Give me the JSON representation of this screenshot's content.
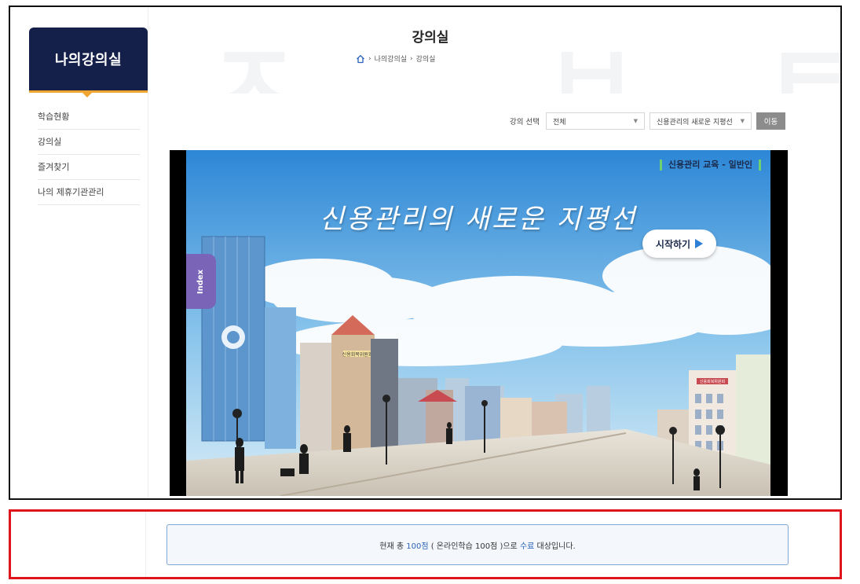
{
  "sidebar": {
    "title": "나의강의실",
    "items": [
      {
        "label": "학습현황"
      },
      {
        "label": "강의실"
      },
      {
        "label": "즐겨찾기"
      },
      {
        "label": "나의 제휴기관관리"
      }
    ]
  },
  "header": {
    "title": "강의실",
    "breadcrumb": [
      "나의강의실",
      "강의실"
    ]
  },
  "filters": {
    "label": "강의 선택",
    "category_selected": "전체",
    "course_selected": "신용관리의 새로운 지평선",
    "go_label": "이동"
  },
  "player": {
    "course_tag": "신용관리 교육 - 일반인",
    "title": "신용관리의 새로운 지평선",
    "start_label": "시작하기",
    "index_label": "Index",
    "building_sign_1": "신용회복위원회",
    "building_sign_2": "신용회복위원회"
  },
  "notice": {
    "prefix": "현재 총",
    "total": "100점",
    "mid": "( 온라인학습 100점 )으로",
    "status": "수료",
    "suffix": "대상입니다."
  },
  "colors": {
    "sidebar_bg": "#15204a",
    "accent": "#f0a531",
    "highlight": "#2a62b8",
    "border_red": "#e0141c"
  }
}
